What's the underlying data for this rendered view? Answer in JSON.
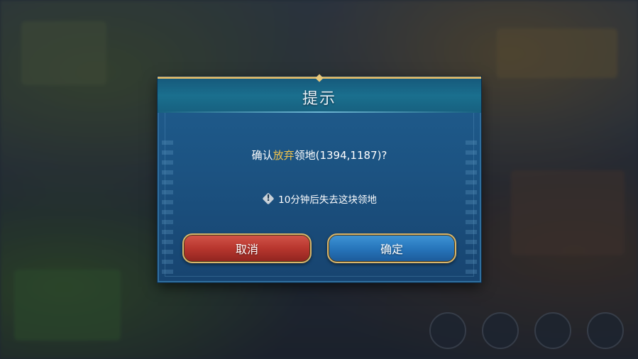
{
  "dialog": {
    "title": "提示",
    "question_prefix": "确认",
    "question_highlight": "放弃",
    "question_suffix": "领地(1394,1187)?",
    "notice": "10分钟后失去这块领地",
    "notice_icon": "warning-icon",
    "cancel_label": "取消",
    "confirm_label": "确定"
  },
  "colors": {
    "highlight": "#f3c44b",
    "cancel_button": "#b8362e",
    "confirm_button": "#2776bc",
    "frame_gold": "#d8b66a"
  }
}
